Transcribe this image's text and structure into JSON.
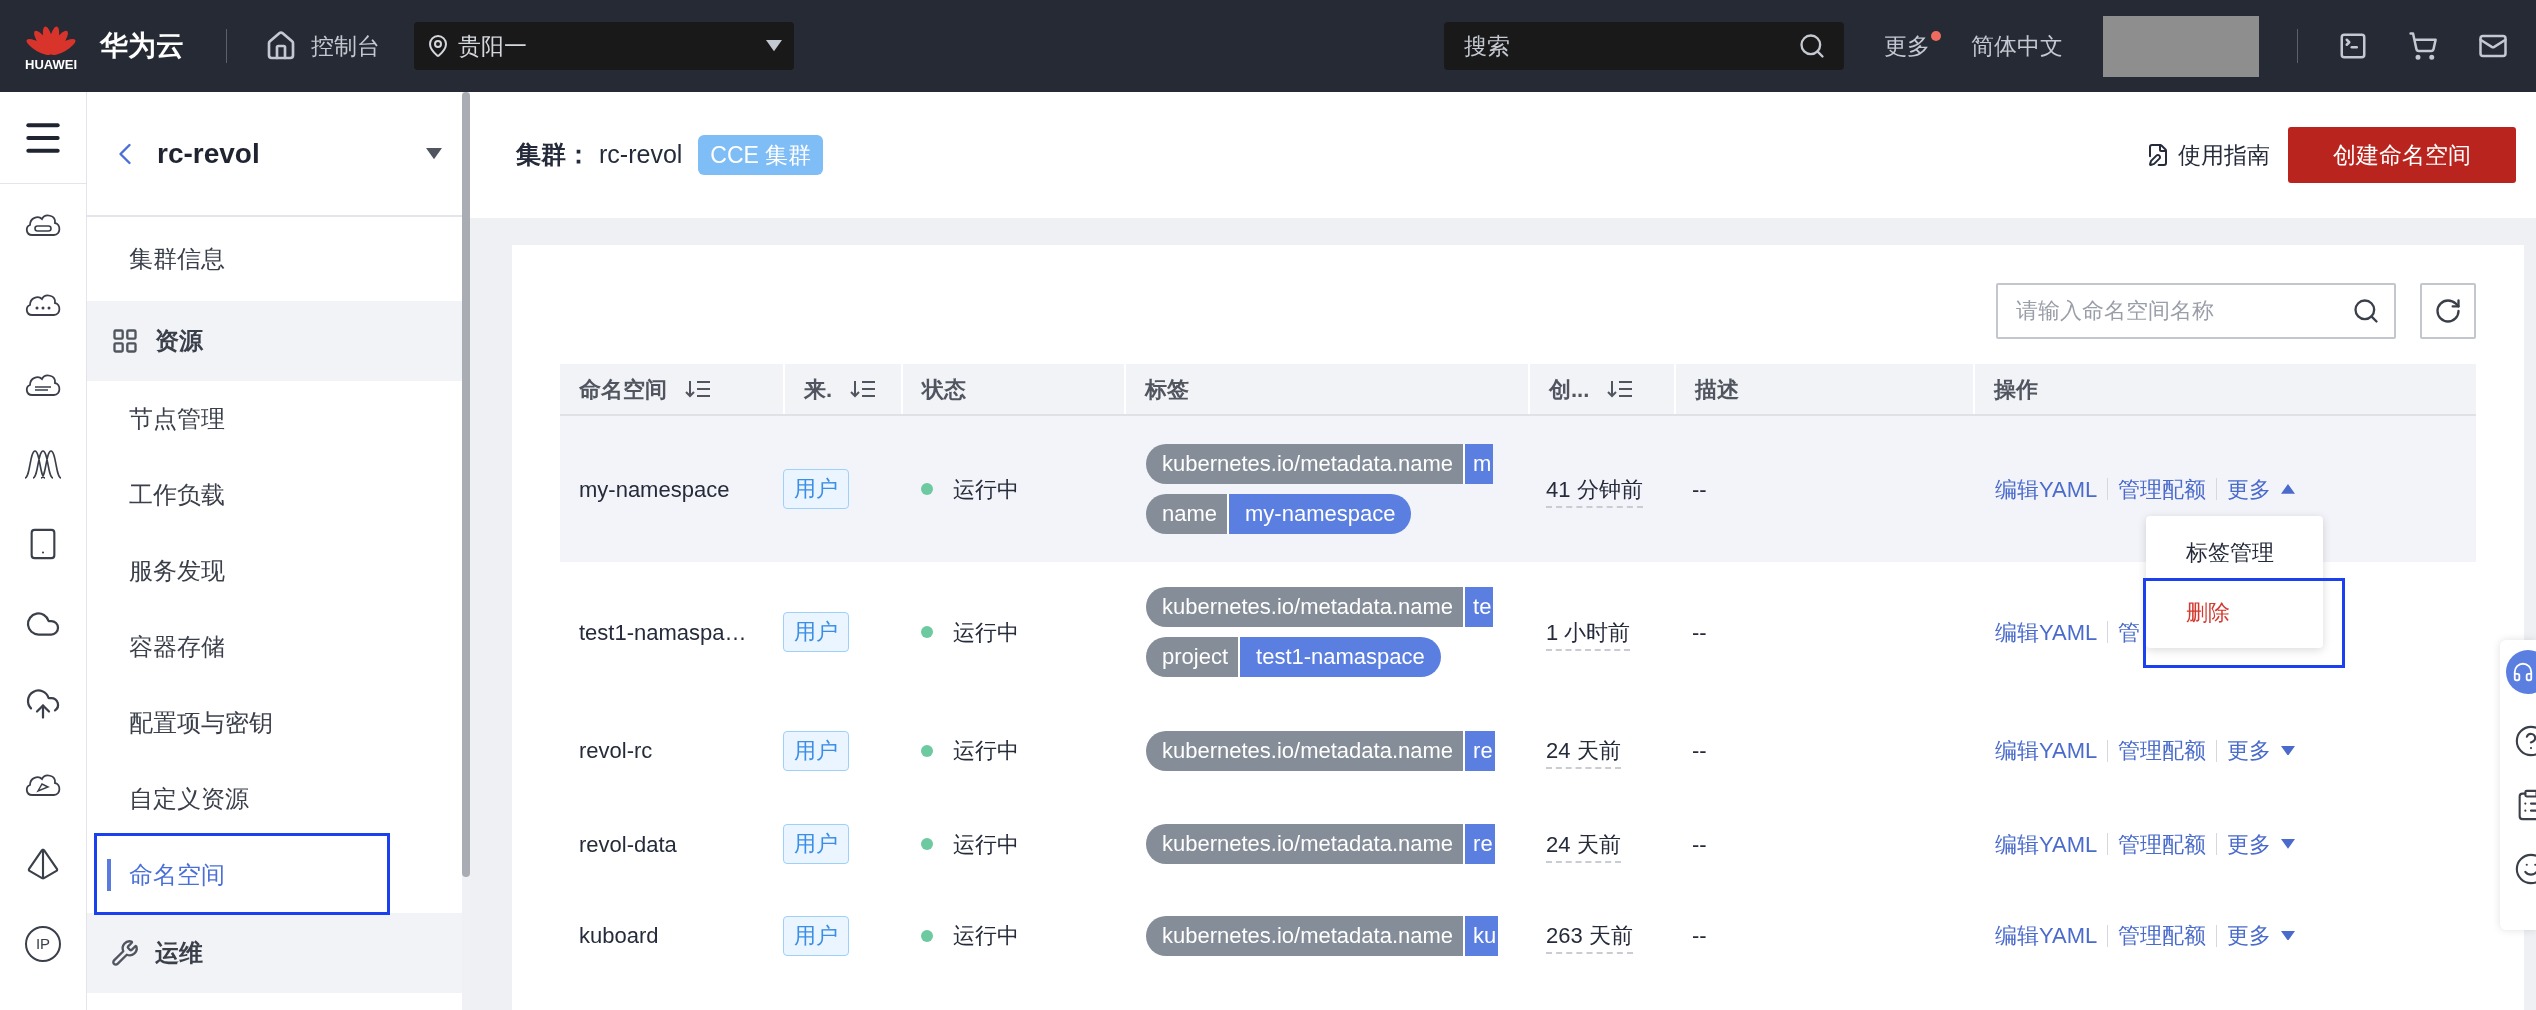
{
  "top_bar": {
    "logo_text": "HUAWEI",
    "brand": "华为云",
    "console": "控制台",
    "region": "贵阳一",
    "search_placeholder": "搜索",
    "more": "更多",
    "more_notification": true,
    "language": "简体中文"
  },
  "icon_rail": {
    "ip_text": "IP"
  },
  "cluster_nav": {
    "cluster": "rc-revol",
    "items": [
      {
        "kind": "item",
        "label": "集群信息",
        "selected": false,
        "highlighted": false
      },
      {
        "kind": "section",
        "label": "资源"
      },
      {
        "kind": "item",
        "label": "节点管理",
        "selected": false,
        "highlighted": false
      },
      {
        "kind": "item",
        "label": "工作负载",
        "selected": false,
        "highlighted": false
      },
      {
        "kind": "item",
        "label": "服务发现",
        "selected": false,
        "highlighted": false
      },
      {
        "kind": "item",
        "label": "容器存储",
        "selected": false,
        "highlighted": false
      },
      {
        "kind": "item",
        "label": "配置项与密钥",
        "selected": false,
        "highlighted": false
      },
      {
        "kind": "item",
        "label": "自定义资源",
        "selected": false,
        "highlighted": false
      },
      {
        "kind": "item",
        "label": "命名空间",
        "selected": true,
        "highlighted": true
      },
      {
        "kind": "section",
        "label": "运维"
      }
    ]
  },
  "header": {
    "label": "集群：",
    "cluster": "rc-revol",
    "badge": "CCE 集群",
    "guide": "使用指南",
    "create_button": "创建命名空间"
  },
  "table": {
    "search_placeholder": "请输入命名空间名称",
    "columns": [
      {
        "label": "命名空间",
        "sortable": true
      },
      {
        "label": "来.",
        "sortable": true
      },
      {
        "label": "状态",
        "sortable": false
      },
      {
        "label": "标签",
        "sortable": false
      },
      {
        "label": "创...",
        "sortable": true
      },
      {
        "label": "描述",
        "sortable": false
      },
      {
        "label": "操作",
        "sortable": false
      }
    ],
    "rows": [
      {
        "name": "my-namespace",
        "source": "用户",
        "status": "运行中",
        "labels": [
          {
            "key": "kubernetes.io/metadata.name",
            "value": "m",
            "cut": true
          },
          {
            "key": "name",
            "value": "my-namespace",
            "cut": false
          }
        ],
        "created": "41 分钟前",
        "description": "--",
        "actions": [
          "编辑YAML",
          "管理配额"
        ],
        "more": "更多",
        "expanded": true,
        "menu": [
          {
            "label": "标签管理",
            "kind": "normal",
            "highlighted": false
          },
          {
            "label": "删除",
            "kind": "danger",
            "highlighted": true
          }
        ]
      },
      {
        "name": "test1-namaspa…",
        "source": "用户",
        "status": "运行中",
        "labels": [
          {
            "key": "kubernetes.io/metadata.name",
            "value": "te",
            "cut": true
          },
          {
            "key": "project",
            "value": "test1-namaspace",
            "cut": false
          }
        ],
        "created": "1 小时前",
        "description": "--",
        "actions": [
          "编辑YAML",
          "管"
        ],
        "expanded": false
      },
      {
        "name": "revol-rc",
        "source": "用户",
        "status": "运行中",
        "labels": [
          {
            "key": "kubernetes.io/metadata.name",
            "value": "re",
            "cut": true
          }
        ],
        "created": "24 天前",
        "description": "--",
        "actions": [
          "编辑YAML",
          "管理配额"
        ],
        "more": "更多",
        "expanded": false
      },
      {
        "name": "revol-data",
        "source": "用户",
        "status": "运行中",
        "labels": [
          {
            "key": "kubernetes.io/metadata.name",
            "value": "re",
            "cut": true
          }
        ],
        "created": "24 天前",
        "description": "--",
        "actions": [
          "编辑YAML",
          "管理配额"
        ],
        "more": "更多",
        "expanded": false
      },
      {
        "name": "kuboard",
        "source": "用户",
        "status": "运行中",
        "labels": [
          {
            "key": "kubernetes.io/metadata.name",
            "value": "ku",
            "cut": true
          }
        ],
        "created": "263 天前",
        "description": "--",
        "actions": [
          "编辑YAML",
          "管理配额"
        ],
        "more": "更多",
        "expanded": false
      }
    ]
  }
}
